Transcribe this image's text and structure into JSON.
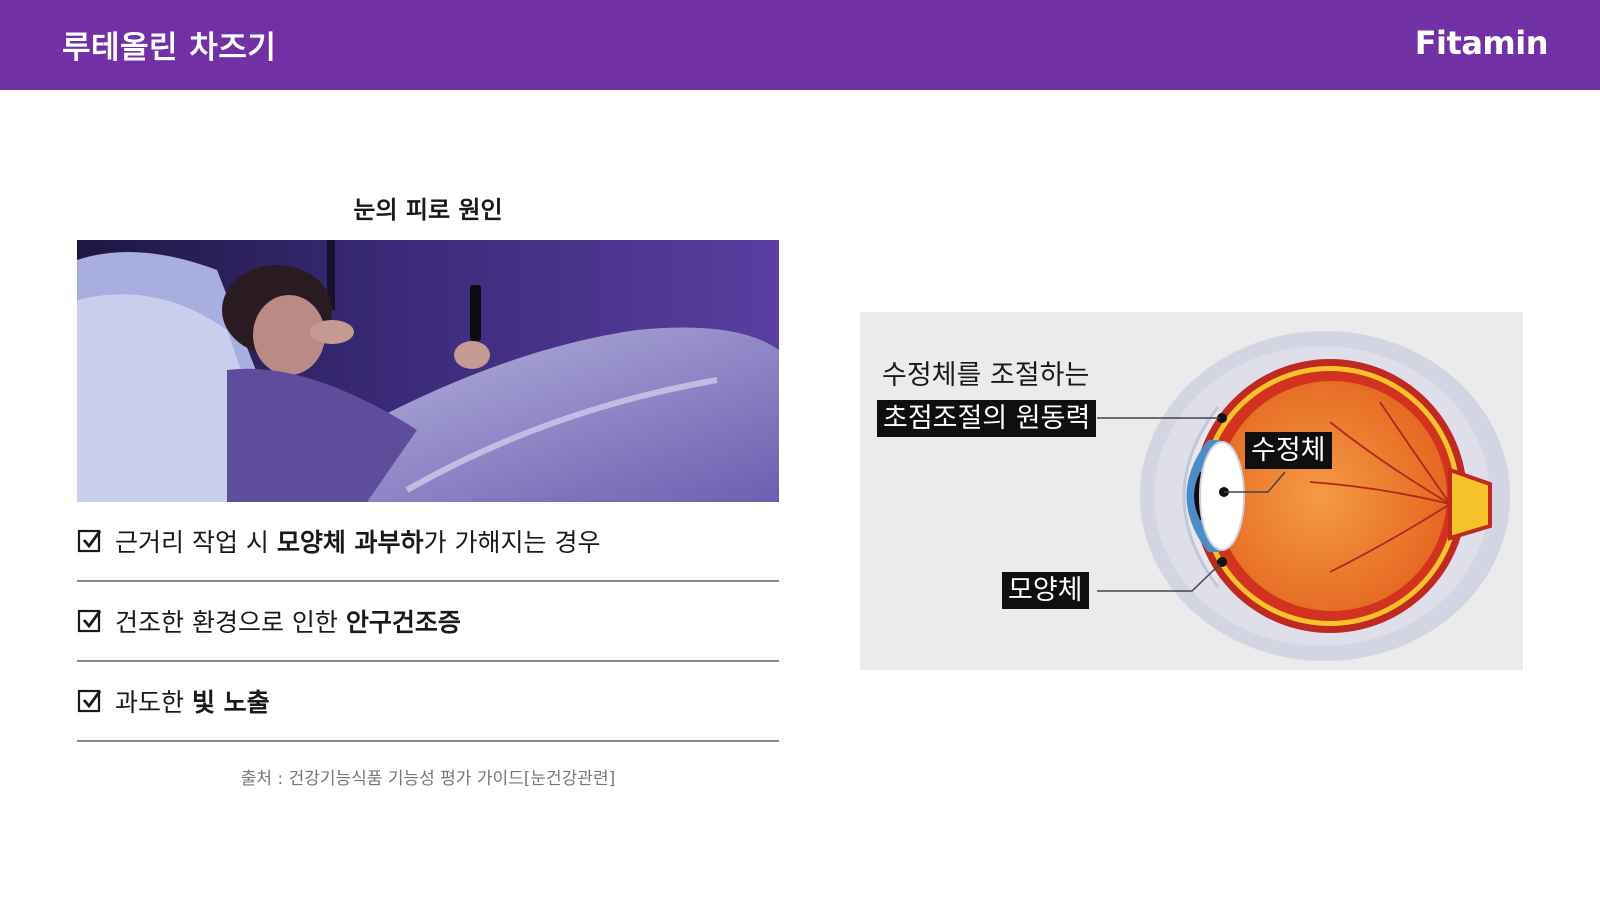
{
  "header": {
    "title": "루테올린 차즈기",
    "brand": "Fitamin"
  },
  "section": {
    "title": "눈의 피로 원인"
  },
  "causes": [
    {
      "pre": "근거리 작업 시 ",
      "bold": "모양체 과부하",
      "post": "가 가해지는 경우"
    },
    {
      "pre": "건조한 환경으로 인한 ",
      "bold": "안구건조증",
      "post": ""
    },
    {
      "pre": "과도한 ",
      "bold": "빛 노출",
      "post": ""
    }
  ],
  "source": "출처 : 건강기능식품 기능성 평가 가이드[눈건강관련]",
  "diagram": {
    "caption_line1": "수정체를 조절하는",
    "caption_line2": "초점조절의 원동력",
    "label_lens": "수정체",
    "label_ciliary": "모양체"
  },
  "colors": {
    "header_bg": "#7131a5",
    "eye_orange": "#ee7a2a",
    "eye_red": "#c0291f",
    "eye_yellow": "#f6c229",
    "iris_blue": "#4c8cc8"
  }
}
